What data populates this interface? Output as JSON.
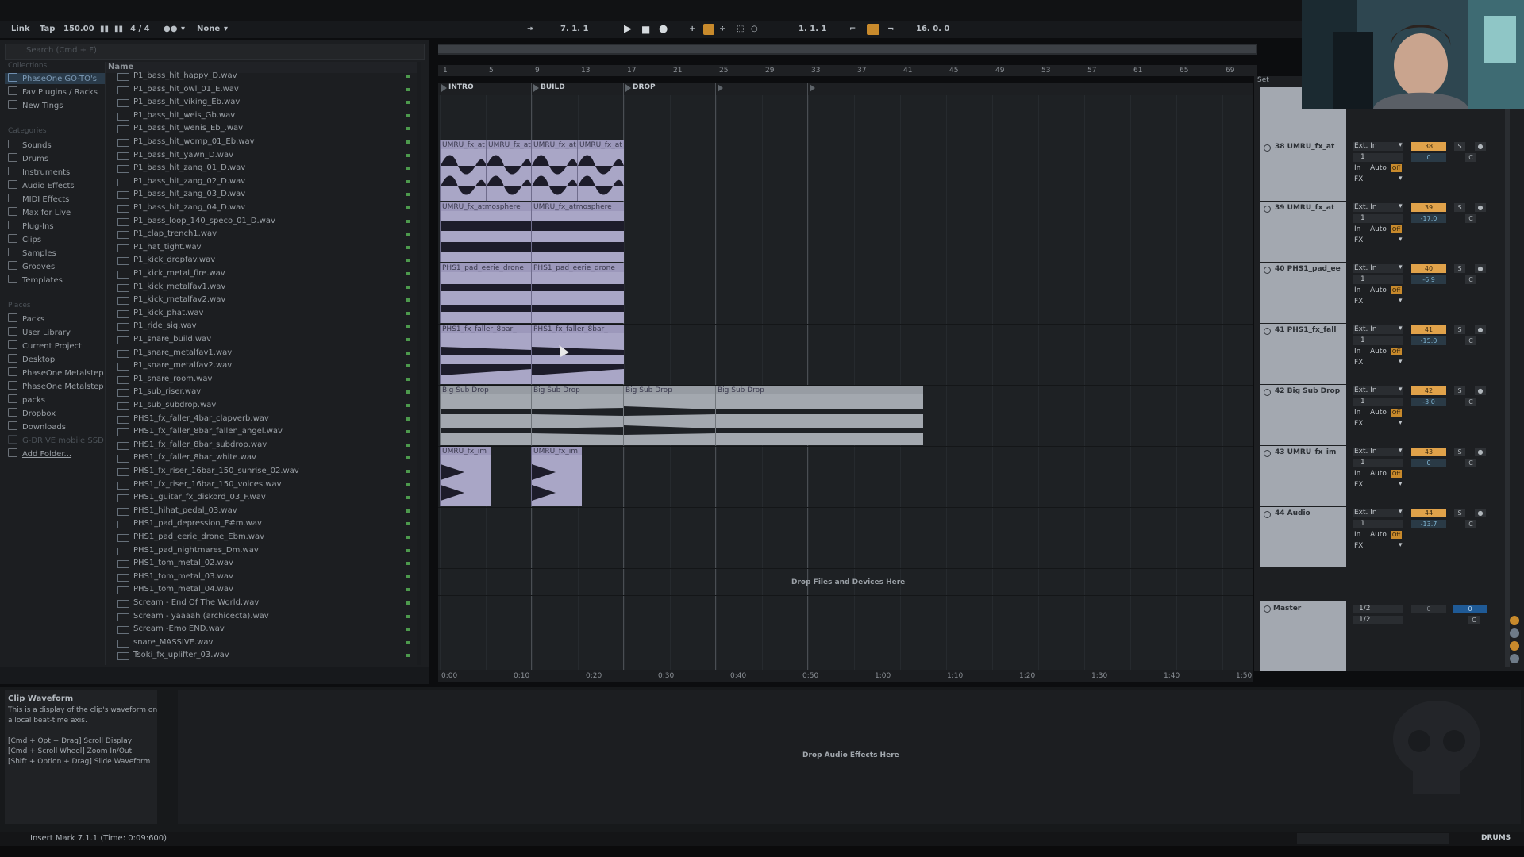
{
  "control_bar": {
    "link": "Link",
    "tap": "Tap",
    "tempo": "150.00",
    "time_signature": "4 / 4",
    "quantize": "None",
    "position": "7.  1.  1",
    "loop_start": "1.  1.  1",
    "loop_length": "16.  0.  0"
  },
  "browser": {
    "search_placeholder": "Search (Cmd + F)",
    "collections_head": "Collections",
    "collections": [
      "PhaseOne GO-TO's",
      "Fav Plugins / Racks",
      "New Tings"
    ],
    "categories_head": "Categories",
    "categories": [
      "Sounds",
      "Drums",
      "Instruments",
      "Audio Effects",
      "MIDI Effects",
      "Max for Live",
      "Plug-Ins",
      "Clips",
      "Samples",
      "Grooves",
      "Templates"
    ],
    "places_head": "Places",
    "places": [
      "Packs",
      "User Library",
      "Current Project",
      "Desktop",
      "PhaseOne Metalstep",
      "PhaseOne Metalstep",
      "packs",
      "Dropbox",
      "Downloads",
      "G-DRIVE mobile SSD",
      "Add Folder..."
    ],
    "column_name": "Name",
    "files": [
      "P1_bass_hit_happy_D.wav",
      "P1_bass_hit_owl_01_E.wav",
      "P1_bass_hit_viking_Eb.wav",
      "P1_bass_hit_weis_Gb.wav",
      "P1_bass_hit_wenis_Eb_.wav",
      "P1_bass_hit_womp_01_Eb.wav",
      "P1_bass_hit_yawn_D.wav",
      "P1_bass_hit_zang_01_D.wav",
      "P1_bass_hit_zang_02_D.wav",
      "P1_bass_hit_zang_03_D.wav",
      "P1_bass_hit_zang_04_D.wav",
      "P1_bass_loop_140_speco_01_D.wav",
      "P1_clap_trench1.wav",
      "P1_hat_tight.wav",
      "P1_kick_dropfav.wav",
      "P1_kick_metal_fire.wav",
      "P1_kick_metalfav1.wav",
      "P1_kick_metalfav2.wav",
      "P1_kick_phat.wav",
      "P1_ride_sig.wav",
      "P1_snare_build.wav",
      "P1_snare_metalfav1.wav",
      "P1_snare_metalfav2.wav",
      "P1_snare_room.wav",
      "P1_sub_riser.wav",
      "P1_sub_subdrop.wav",
      "PHS1_fx_faller_4bar_clapverb.wav",
      "PHS1_fx_faller_8bar_fallen_angel.wav",
      "PHS1_fx_faller_8bar_subdrop.wav",
      "PHS1_fx_faller_8bar_white.wav",
      "PHS1_fx_riser_16bar_150_sunrise_02.wav",
      "PHS1_fx_riser_16bar_150_voices.wav",
      "PHS1_guitar_fx_diskord_03_F.wav",
      "PHS1_hihat_pedal_03.wav",
      "PHS1_pad_depression_F#m.wav",
      "PHS1_pad_eerie_drone_Ebm.wav",
      "PHS1_pad_nightmares_Dm.wav",
      "PHS1_tom_metal_02.wav",
      "PHS1_tom_metal_03.wav",
      "PHS1_tom_metal_04.wav",
      "Scream - End Of The World.wav",
      "Scream - yaaaah (archicecta).wav",
      "Scream -Emo END.wav",
      "snare_MASSIVE.wav",
      "Tsoki_fx_uplifter_03.wav"
    ]
  },
  "arrangement": {
    "bar_numbers": [
      "1",
      "5",
      "9",
      "13",
      "17",
      "21",
      "25",
      "29",
      "33",
      "37",
      "41",
      "45",
      "49",
      "53",
      "57",
      "61",
      "65",
      "69"
    ],
    "locators": [
      "INTRO",
      "BUILD",
      "DROP"
    ],
    "set_label": "Set",
    "clips": {
      "umru_fx_at": "UMRU_fx_at",
      "umru_fx_atmosphere": "UMRU_fx_atmosphere",
      "phs1_pad_eerie": "PHS1_pad_eerie_drone",
      "phs1_fx_faller": "PHS1_fx_faller_8bar_",
      "big_sub_drop": "Big Sub Drop",
      "umru_fx_im": "UMRU_fx_im"
    },
    "drop_files": "Drop Files and Devices Here",
    "time_labels": [
      "0:00",
      "0:10",
      "0:20",
      "0:30",
      "0:40",
      "0:50",
      "1:00",
      "1:10",
      "1:20",
      "1:30",
      "1:40",
      "1:50"
    ]
  },
  "tracks": [
    {
      "name": "38 UMRU_fx_at",
      "input": "Ext. In",
      "channel": "1",
      "num": "38",
      "vol": "0",
      "pan": "C"
    },
    {
      "name": "39 UMRU_fx_at",
      "input": "Ext. In",
      "channel": "1",
      "num": "39",
      "vol": "-17.0",
      "pan": "C"
    },
    {
      "name": "40 PHS1_pad_ee",
      "input": "Ext. In",
      "channel": "1",
      "num": "40",
      "vol": "-6.9",
      "pan": "C"
    },
    {
      "name": "41 PHS1_fx_fall",
      "input": "Ext. In",
      "channel": "1",
      "num": "41",
      "vol": "-15.0",
      "pan": "C"
    },
    {
      "name": "42 Big Sub Drop",
      "input": "Ext. In",
      "channel": "1",
      "num": "42",
      "vol": "-3.0",
      "pan": "C"
    },
    {
      "name": "43 UMRU_fx_im",
      "input": "Ext. In",
      "channel": "1",
      "num": "43",
      "vol": "0",
      "pan": "C"
    },
    {
      "name": "44 Audio",
      "input": "Ext. In",
      "channel": "1",
      "num": "44",
      "vol": "-13.7",
      "pan": "C"
    }
  ],
  "track_labels": {
    "in": "In",
    "auto": "Auto",
    "off": "Off",
    "fx": "FX",
    "solo": "S"
  },
  "master": {
    "name": "Master",
    "out1": "1/2",
    "out2": "1/2",
    "vol": "0",
    "vol2": "0",
    "pan": "C"
  },
  "detail": {
    "info_title": "Clip Waveform",
    "info_lines": [
      "This is a display of the clip's waveform on",
      "a local beat-time axis.",
      "",
      "[Cmd + Opt + Drag] Scroll Display",
      "[Cmd + Scroll Wheel] Zoom In/Out",
      "[Shift + Option + Drag] Slide Waveform"
    ],
    "drop_effects": "Drop Audio Effects Here"
  },
  "status": {
    "text": "Insert Mark 7.1.1 (Time: 0:09:600)",
    "right": "DRUMS"
  },
  "colors": {
    "clip_purple": "#a9a6c6",
    "clip_gray": "#a3a8af",
    "track_orange": "#e0a24a",
    "master_blue": "#1f5a96"
  }
}
